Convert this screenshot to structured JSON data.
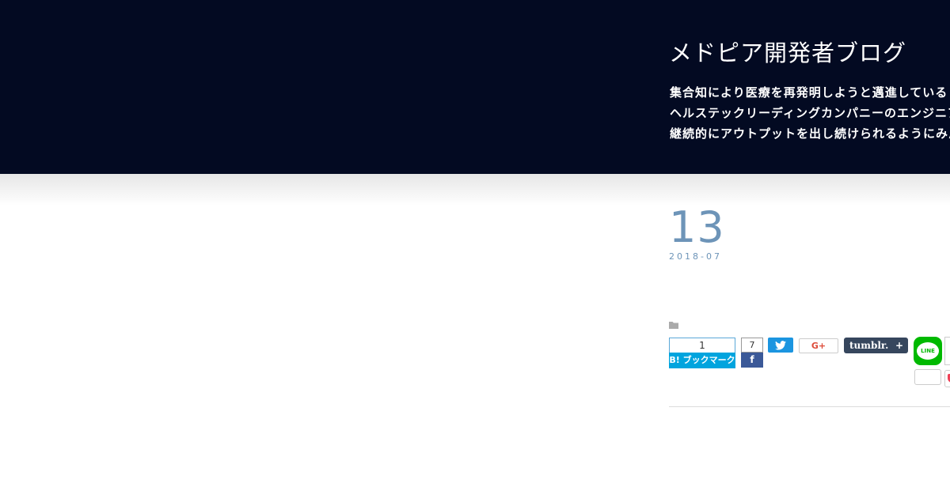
{
  "header": {
    "blog_title": "メドピア開発者ブログ",
    "description_lines": [
      "集合知により医療を再発明しようと邁進している",
      "ヘルステックリーディングカンパニーのエンジニア",
      "継続的にアウトプットを出し続けられるようにみん"
    ]
  },
  "post": {
    "day": "13",
    "year_month": "2018-07"
  },
  "share": {
    "hatena": {
      "count": "1",
      "label": "B! ブックマーク"
    },
    "facebook": {
      "count": "7",
      "label": "f"
    },
    "gplus": {
      "label": "G+"
    },
    "tumblr": {
      "label": "tumblr.",
      "plus": "+"
    },
    "line": {
      "label": "LINE"
    }
  },
  "colors": {
    "header_bg": "#030a22",
    "date_blue": "#6d94b8",
    "hatena_blue": "#00a4de",
    "facebook_blue": "#3b5998",
    "twitter_blue": "#1b95e0",
    "tumblr_navy": "#36465d",
    "line_green": "#00b900",
    "pocket_red": "#ef4056"
  }
}
